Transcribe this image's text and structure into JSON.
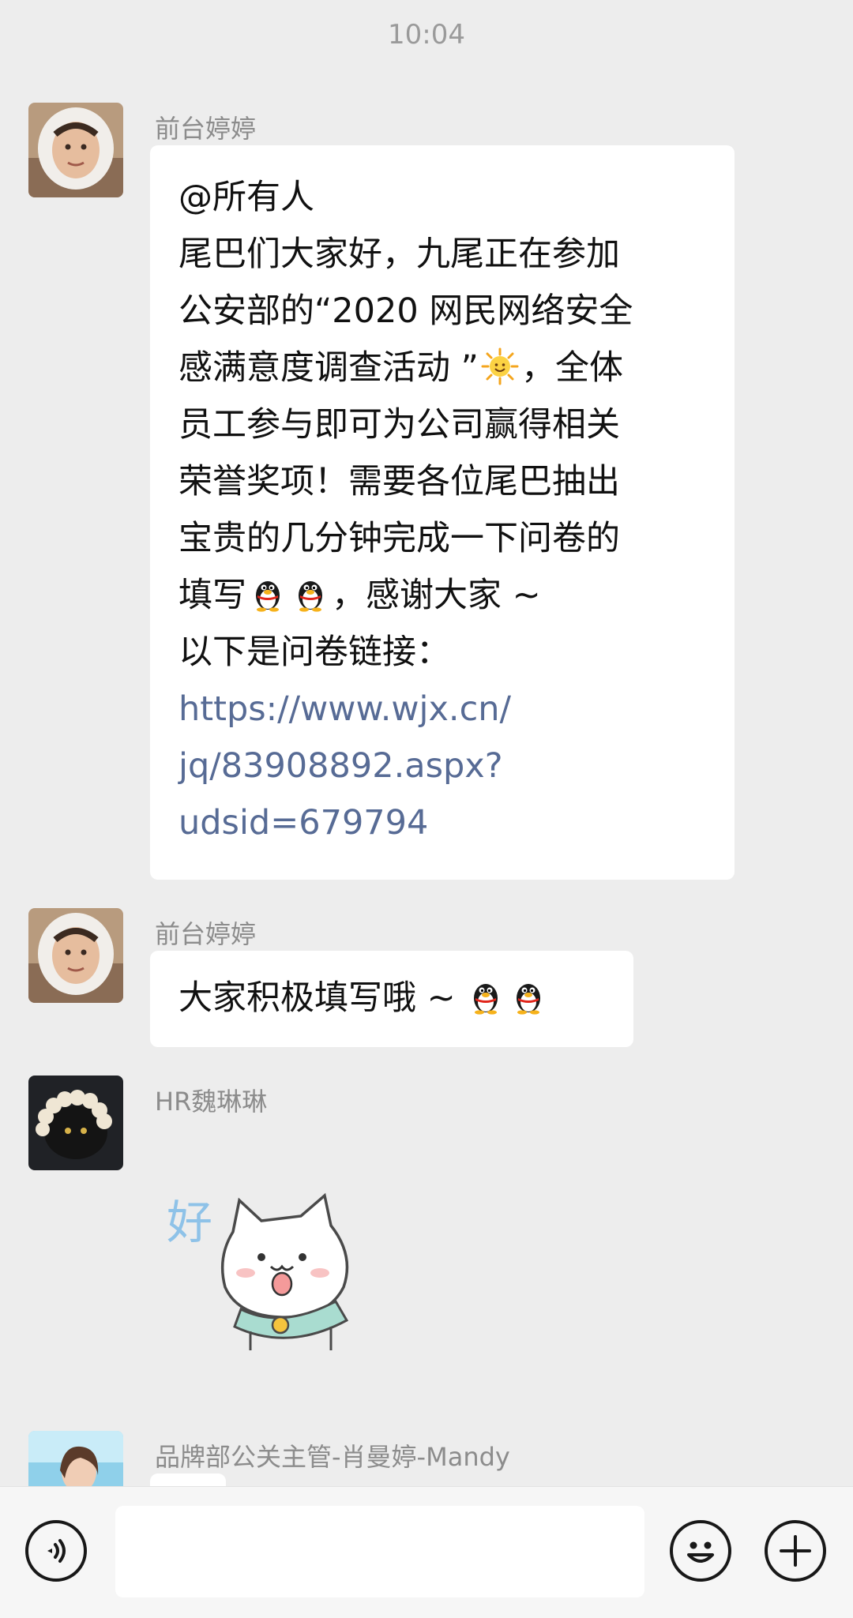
{
  "status": {
    "time": "10:04"
  },
  "messages": [
    {
      "sender": "前台婷婷",
      "lines": [
        "@所有人",
        "尾巴们大家好，九尾正在参加",
        "公安部的“2020 网民网络安全",
        "感满意度调查活动 ”",
        "，全体",
        "员工参与即可为公司赢得相关",
        "荣誉奖项！需要各位尾巴抽出",
        "宝贵的几分钟完成一下问卷的",
        "填写",
        "，感谢大家 ~",
        "以下是问卷链接："
      ],
      "link_lines": [
        "https://www.wjx.cn/",
        "jq/83908892.aspx?",
        "udsid=679794"
      ],
      "emoji": {
        "sun": "sun-emoji",
        "penguin": "penguin-emoji"
      }
    },
    {
      "sender": "前台婷婷",
      "text": "大家积极填写哦 ~",
      "emoji": "penguin-emoji"
    },
    {
      "sender": "HR魏琳琳",
      "sticker": {
        "text": "好",
        "icon": "cat-sticker"
      }
    },
    {
      "sender": "品牌部公关主管-肖曼婷-Mandy"
    }
  ],
  "input_bar": {
    "voice_icon": "voice-icon",
    "text_value": "",
    "emoji_icon": "smiley-icon",
    "plus_icon": "plus-icon"
  },
  "colors": {
    "background": "#ededed",
    "bubble": "#ffffff",
    "link": "#576b95",
    "sender": "#8c8c8c"
  }
}
